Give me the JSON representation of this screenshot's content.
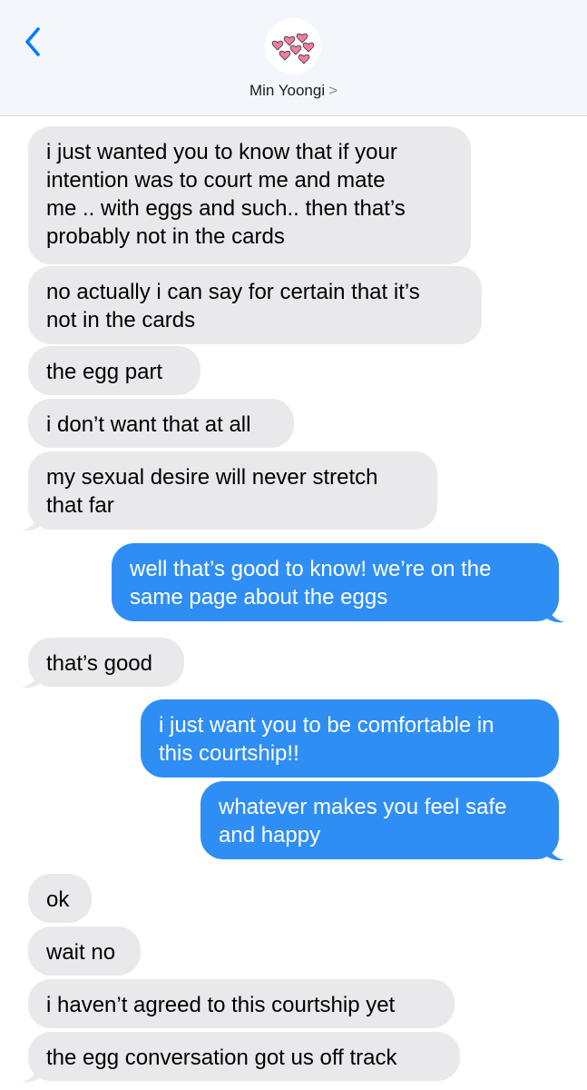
{
  "header": {
    "back_icon": "chevron-left-icon",
    "avatar_icon": "hearts-icon",
    "contact_name": "Min Yoongi",
    "chevron": ">"
  },
  "colors": {
    "incoming_bubble": "#e9e9eb",
    "outgoing_bubble": "#2f8ef4",
    "accent": "#007aff"
  },
  "messages": [
    {
      "from": "them",
      "lines": [
        "i just wanted you to know that if your",
        "intention was to court me and mate",
        "me .. with eggs and such.. then that’s",
        "probably not in the cards"
      ]
    },
    {
      "from": "them",
      "lines": [
        "no actually i can say for certain that it’s",
        "not in the cards"
      ]
    },
    {
      "from": "them",
      "lines": [
        "the egg part"
      ]
    },
    {
      "from": "them",
      "lines": [
        "i don’t want that at all"
      ]
    },
    {
      "from": "them",
      "lines": [
        "my sexual desire will never stretch",
        "that far"
      ]
    },
    {
      "from": "me",
      "lines": [
        "well that’s good to know! we’re on the",
        "same page about the eggs"
      ]
    },
    {
      "from": "them",
      "lines": [
        "that’s good"
      ]
    },
    {
      "from": "me",
      "lines": [
        "i just want you to be comfortable in",
        "this courtship!!"
      ]
    },
    {
      "from": "me",
      "lines": [
        "whatever makes you feel safe",
        "and happy"
      ]
    },
    {
      "from": "them",
      "lines": [
        "ok"
      ]
    },
    {
      "from": "them",
      "lines": [
        "wait no"
      ]
    },
    {
      "from": "them",
      "lines": [
        "i haven’t agreed to this courtship yet"
      ]
    },
    {
      "from": "them",
      "lines": [
        "the egg conversation got us off track"
      ]
    }
  ]
}
